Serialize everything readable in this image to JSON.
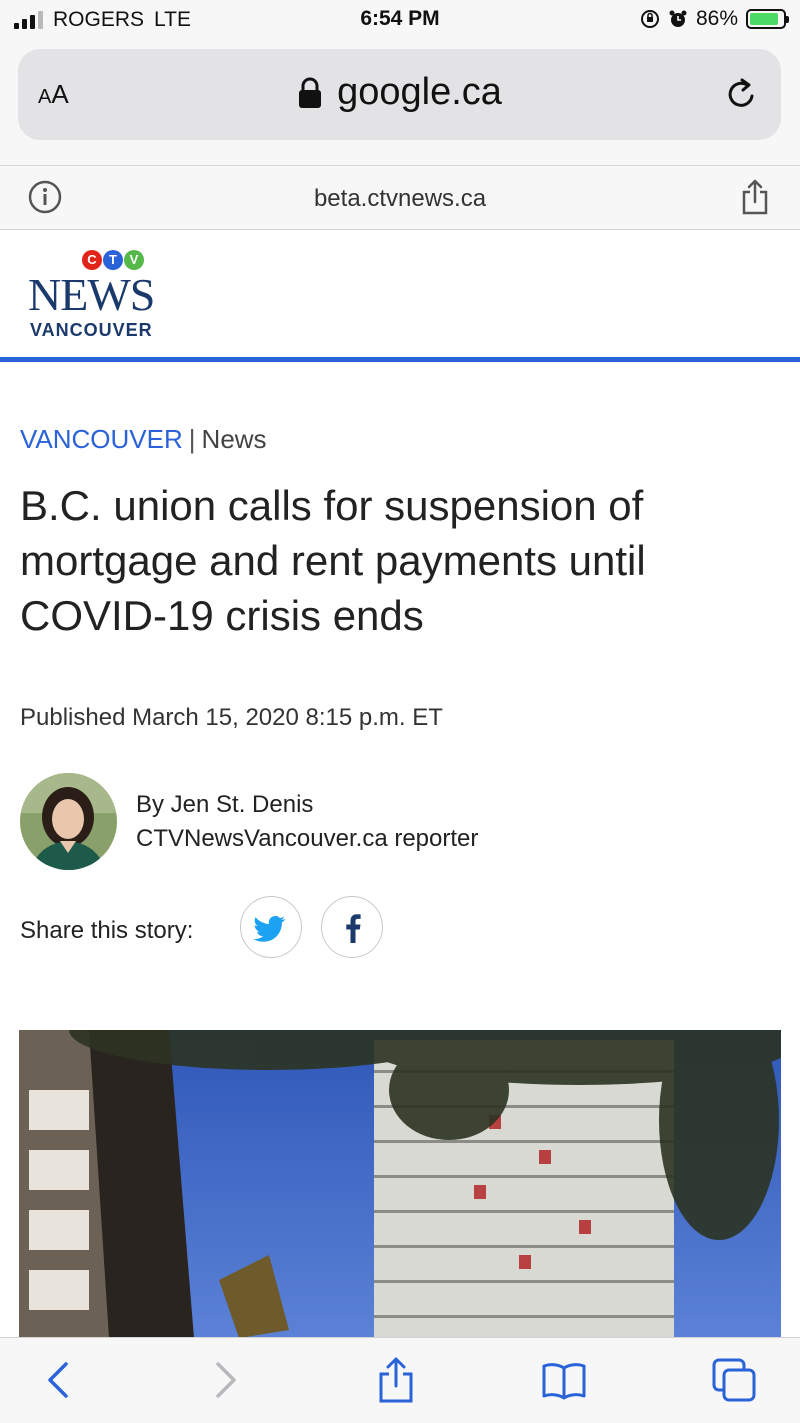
{
  "status": {
    "carrier": "ROGERS",
    "network": "LTE",
    "time": "6:54 PM",
    "battery": "86%",
    "battery_level": 0.86,
    "battery_color": "#4cd964"
  },
  "browser": {
    "text_size_label_small": "A",
    "text_size_label_large": "A",
    "url": "google.ca",
    "page_domain": "beta.ctvnews.ca",
    "icons": [
      "aa-text-size-icon",
      "lock-icon",
      "reload-icon",
      "info-icon",
      "share-icon"
    ]
  },
  "site": {
    "logo": {
      "ctv_letters": [
        "C",
        "T",
        "V"
      ],
      "ctv_colors": [
        "#e2231a",
        "#2a62d8",
        "#55b848"
      ],
      "news": "NEWS",
      "city": "VANCOUVER",
      "brand_color": "#1b3a6b"
    },
    "accent_color": "#2a62d8"
  },
  "article": {
    "section": "VANCOUVER",
    "separator": "|",
    "category": "News",
    "headline": "B.C. union calls for suspension of mortgage and rent payments until COVID-19 crisis ends",
    "published": "Published March 15, 2020 8:15 p.m. ET",
    "author_name": "By Jen St. Denis",
    "author_role": "CTVNewsVancouver.ca reporter",
    "share_label": "Share this story:",
    "share_icons": [
      "twitter-icon",
      "facebook-icon"
    ]
  },
  "toolbar": {
    "icons": [
      "back-icon",
      "forward-icon",
      "share-icon",
      "bookmarks-icon",
      "tabs-icon"
    ],
    "forward_enabled": false
  }
}
